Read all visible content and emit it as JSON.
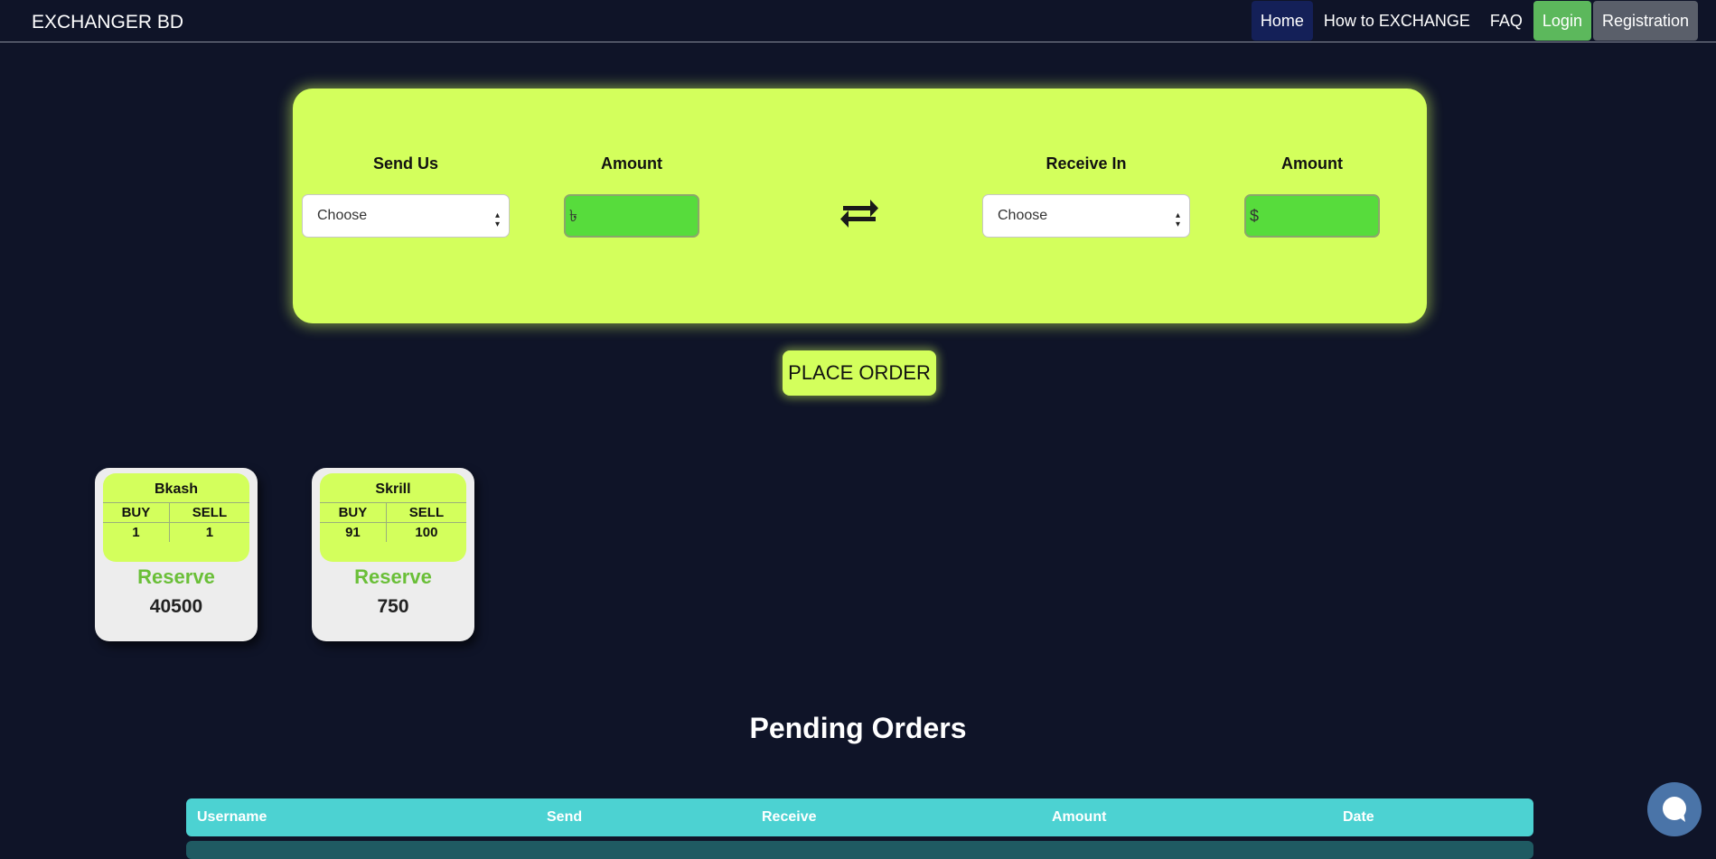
{
  "navbar": {
    "brand": "EXCHANGER BD",
    "links": [
      {
        "label": "Home"
      },
      {
        "label": "How to EXCHANGE"
      },
      {
        "label": "FAQ"
      },
      {
        "label": "Login"
      },
      {
        "label": "Registration"
      }
    ]
  },
  "exchange": {
    "send_label": "Send Us",
    "send_amount_label": "Amount",
    "receive_label": "Receive In",
    "receive_amount_label": "Amount",
    "send_select_value": "Choose",
    "receive_select_value": "Choose",
    "send_currency_symbol": "৳",
    "receive_currency_symbol": "$",
    "place_order_label": "PLACE ORDER"
  },
  "rates": [
    {
      "name": "Bkash",
      "buy_label": "BUY",
      "sell_label": "SELL",
      "buy": "1",
      "sell": "1",
      "reserve_label": "Reserve",
      "reserve": "40500"
    },
    {
      "name": "Skrill",
      "buy_label": "BUY",
      "sell_label": "SELL",
      "buy": "91",
      "sell": "100",
      "reserve_label": "Reserve",
      "reserve": "750"
    }
  ],
  "pending_orders": {
    "title": "Pending Orders",
    "columns": [
      "Username",
      "Send",
      "Receive",
      "Amount",
      "Date"
    ]
  },
  "colors": {
    "page_bg": "#0f1428",
    "accent_lime": "#d3ff5c",
    "input_green": "#57dc3c",
    "table_header": "#4cd2d2",
    "reserve_green": "#6abf38"
  },
  "icons": {
    "swap": "swap-arrows-icon",
    "chat": "chat-bubble-icon"
  }
}
